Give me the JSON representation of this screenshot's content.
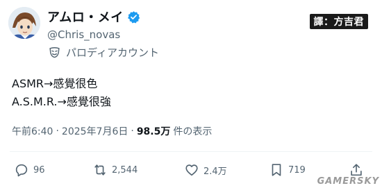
{
  "profile": {
    "display_name": "アムロ・メイ",
    "handle": "@Chris_novas",
    "label": "パロディアカウント",
    "avatar_icon": "anime-character-avatar",
    "verified_icon": "verified-badge-icon",
    "parody_icon": "parody-mask-icon"
  },
  "translator_badge": "譯：方吉君",
  "tweet": {
    "lines": [
      "ASMR→感覺很色",
      "A.S.M.R.→感覺很強"
    ]
  },
  "meta": {
    "time": "午前6:40",
    "separator": "·",
    "date": "2025年7月6日",
    "views": "98.5万",
    "views_label": "件の表示"
  },
  "actions": {
    "replies": "96",
    "retweets": "2,544",
    "likes": "2.4万",
    "views": "719"
  },
  "watermark": "GAMERSKY",
  "colors": {
    "text": "#0f1419",
    "secondary": "#536471",
    "verified": "#1d9bf0"
  }
}
